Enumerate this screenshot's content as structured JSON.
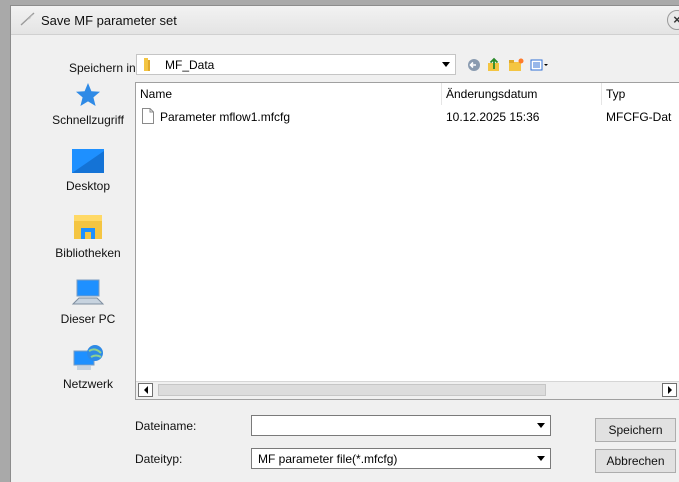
{
  "window": {
    "title": "Save MF parameter set",
    "close_glyph": "×"
  },
  "lookin": {
    "label": "Speichern in:",
    "value": "MF_Data"
  },
  "toolbar_icons": [
    "back-icon",
    "up-folder-icon",
    "new-folder-icon",
    "view-menu-icon"
  ],
  "places": [
    {
      "label": "Schnellzugriff",
      "icon": "quick-access-star-icon"
    },
    {
      "label": "Desktop",
      "icon": "desktop-icon"
    },
    {
      "label": "Bibliotheken",
      "icon": "libraries-icon"
    },
    {
      "label": "Dieser PC",
      "icon": "this-pc-icon"
    },
    {
      "label": "Netzwerk",
      "icon": "network-icon"
    }
  ],
  "filelist": {
    "columns": [
      "Name",
      "Änderungsdatum",
      "Typ"
    ],
    "rows": [
      {
        "name": "Parameter mflow1.mfcfg",
        "date": "10.12.2025 15:36",
        "type": "MFCFG-Dat"
      }
    ]
  },
  "filename": {
    "label": "Dateiname:",
    "value": ""
  },
  "filetype": {
    "label": "Dateityp:",
    "value": "MF parameter file(*.mfcfg)"
  },
  "buttons": {
    "save": "Speichern",
    "cancel": "Abbrechen"
  },
  "colors": {
    "dialog_bg": "#f0f0f0",
    "list_bg": "#ffffff",
    "accent_blue": "#1e90ff",
    "folder_yellow": "#f4c542"
  }
}
